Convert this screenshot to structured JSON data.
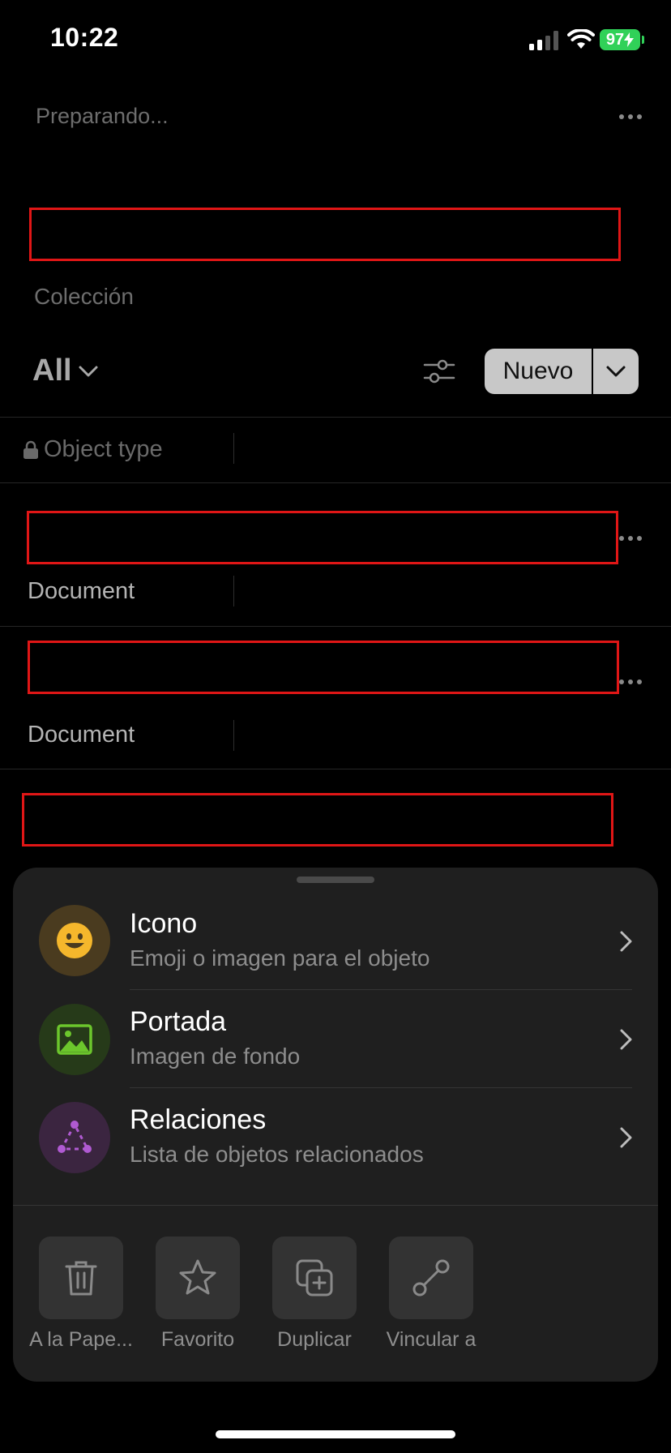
{
  "status_bar": {
    "time": "10:22",
    "battery": "97"
  },
  "header": {
    "status_text": "Preparando..."
  },
  "collection": {
    "label": "Colección"
  },
  "toolbar": {
    "view_label": "All",
    "new_label": "Nuevo"
  },
  "table": {
    "header_column": "Object type",
    "rows": [
      {
        "type": "Document"
      },
      {
        "type": "Document"
      }
    ]
  },
  "sheet": {
    "items": [
      {
        "title": "Icono",
        "subtitle": "Emoji o imagen para el objeto",
        "icon": "emoji-icon",
        "color": "#4a3b1f"
      },
      {
        "title": "Portada",
        "subtitle": "Imagen de fondo",
        "icon": "image-icon",
        "color": "#263a19"
      },
      {
        "title": "Relaciones",
        "subtitle": "Lista de objetos relacionados",
        "icon": "relations-icon",
        "color": "#3b2540"
      }
    ],
    "actions": [
      {
        "label": "A la Pape...",
        "icon": "trash-icon"
      },
      {
        "label": "Favorito",
        "icon": "star-icon"
      },
      {
        "label": "Duplicar",
        "icon": "duplicate-icon"
      },
      {
        "label": "Vincular a",
        "icon": "link-icon"
      }
    ]
  },
  "colors": {
    "accent_red": "#e01616",
    "sheet_bg": "#1f1f1f",
    "emoji_yellow": "#f5b72c",
    "image_green": "#6cc62c",
    "relation_purple": "#b05ad2"
  }
}
